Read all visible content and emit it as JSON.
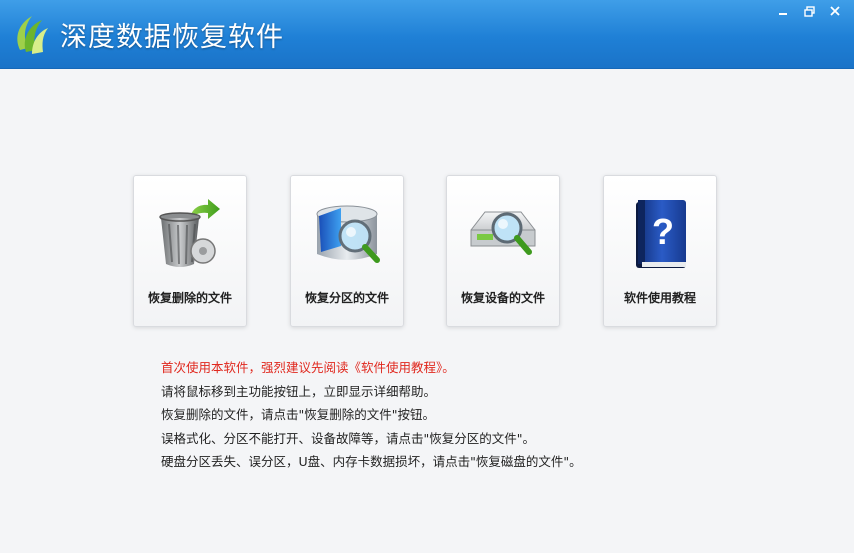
{
  "app": {
    "title": "深度数据恢复软件"
  },
  "window_controls": {
    "minimize": "minimize-icon",
    "restore": "restore-icon",
    "close": "close-icon"
  },
  "cards": [
    {
      "label": "恢复删除的文件",
      "icon": "recycle-bin-icon"
    },
    {
      "label": "恢复分区的文件",
      "icon": "disk-search-icon"
    },
    {
      "label": "恢复设备的文件",
      "icon": "device-search-icon"
    },
    {
      "label": "软件使用教程",
      "icon": "help-book-icon"
    }
  ],
  "info": {
    "warn": "首次使用本软件，强烈建议先阅读《软件使用教程》。",
    "line1": "请将鼠标移到主功能按钮上，立即显示详细帮助。",
    "line2": "恢复删除的文件，请点击\"恢复删除的文件\"按钮。",
    "line3": "误格式化、分区不能打开、设备故障等，请点击\"恢复分区的文件\"。",
    "line4": "硬盘分区丢失、误分区，U盘、内存卡数据损坏，请点击\"恢复磁盘的文件\"。"
  },
  "colors": {
    "titlebar": "#1f80d6",
    "warning_text": "#e0281e"
  }
}
